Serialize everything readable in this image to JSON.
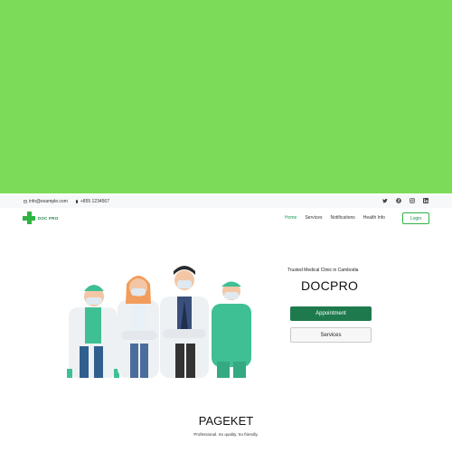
{
  "topbar": {
    "email": "info@example.com",
    "phone": "+855 1234567",
    "social_icons": [
      "twitter-icon",
      "facebook-icon",
      "instagram-icon",
      "linkedin-icon"
    ]
  },
  "navbar": {
    "logo_text": "DOC PRO",
    "links": [
      "Home",
      "Services",
      "Notifications",
      "Health Info"
    ],
    "active_link": "Home",
    "login_label": "Login"
  },
  "hero": {
    "tagline": "Trusted Medical Clinic in Cambodia",
    "brand": "DOCPRO",
    "appointment_label": "Appointment",
    "services_label": "Services"
  },
  "footer": {
    "title": "PAGEKET",
    "subtitle": "Professional. So quality. So friendly."
  },
  "colors": {
    "banner": "#7ddb5a",
    "accent": "#1e7a4d",
    "logo_green": "#2fb344"
  }
}
